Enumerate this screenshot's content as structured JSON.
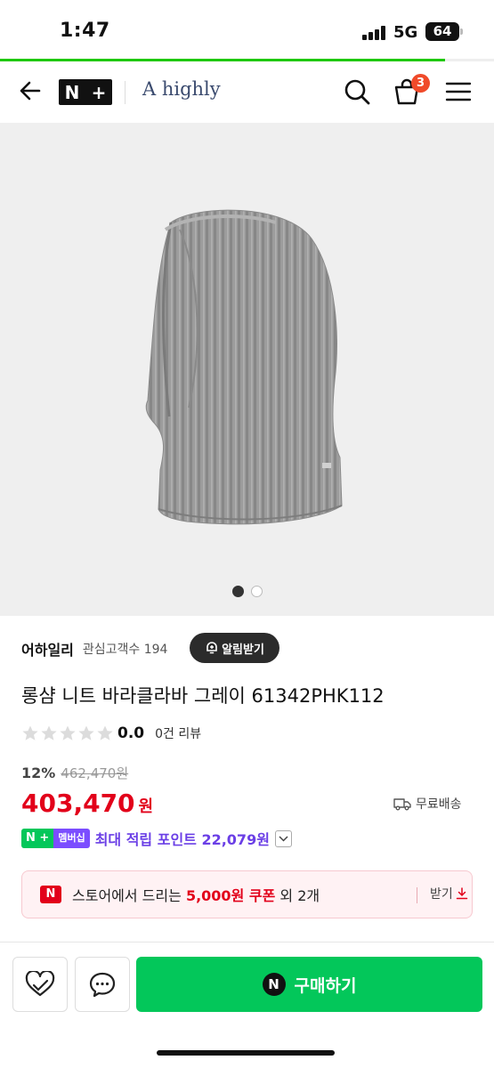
{
  "status_bar": {
    "time": "1:47",
    "network": "5G",
    "battery": "64"
  },
  "page_progress": 0.9,
  "header": {
    "logo_letters": [
      "N",
      "+"
    ],
    "store_name": "A highly",
    "cart_count": "3",
    "icons": [
      "back-arrow-icon",
      "search-icon",
      "cart-icon",
      "menu-icon"
    ]
  },
  "gallery": {
    "slide_count": 2,
    "active_index": 0
  },
  "seller": {
    "name": "어하일리",
    "fans": "관심고객수 194",
    "alarm_label": "알림받기"
  },
  "product": {
    "title": "롱샴 니트 바라클라바 그레이 61342PHK112",
    "rating": "0.0",
    "stars_filled": 0,
    "reviews": "0건 리뷰",
    "discount": "12%",
    "original_price": "462,470원",
    "price": "403,470",
    "price_unit": "원",
    "shipping": "무료배송"
  },
  "membership": {
    "badge_n": "N",
    "badge_plus": "+",
    "badge_label": "멤버십",
    "text": "최대 적립 포인트 22,079원"
  },
  "coupon": {
    "badge": "N",
    "text_prefix": "스토어에서 드리는",
    "amount": "5,000원 쿠폰",
    "text_suffix": "외 2개",
    "get_label": "받기"
  },
  "actions": {
    "buy_label": "구매하기",
    "buy_badge": "N"
  },
  "colors": {
    "accent_green": "#03c75a",
    "price_red": "#e2001a",
    "point_purple": "#6b3fe6",
    "brand_navy": "#3a4a6e"
  }
}
